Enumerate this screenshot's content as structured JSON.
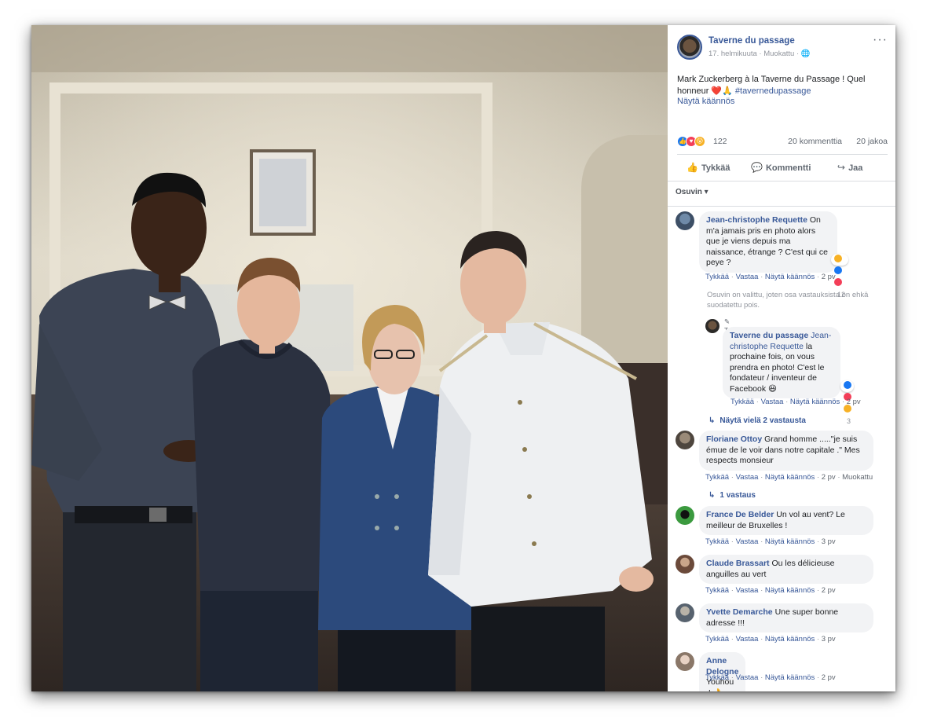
{
  "post": {
    "page_name": "Taverne du passage",
    "meta": "17. helmikuuta · Muokattu ·",
    "more_icon": "···",
    "text": "Mark Zuckerberg à la Taverne du Passage ! Quel honneur ❤️🙏",
    "hashtag": "#tavernedupassage",
    "see_translation": "Näytä käännös",
    "reaction_count": "122",
    "comments_count": "20 kommenttia",
    "shares_count": "20 jakoa",
    "actions": {
      "like": "Tykkää",
      "comment": "Kommentti",
      "share": "Jaa"
    },
    "sort_label": "Osuvin ▾"
  },
  "comments": [
    {
      "author": "Jean-christophe Requette",
      "text": "On m'a jamais pris en photo alors que je viens depuis ma naissance, étrange ? C'est qui ce peye ?",
      "reactions": "12",
      "links": {
        "like": "Tykkää",
        "reply": "Vastaa",
        "translate": "Näytä käännös",
        "time": "2 pv"
      }
    },
    {
      "note": "Osuvin on valittu, joten osa vastauksista on ehkä suodatettu pois."
    },
    {
      "badge": "✎ Tekijä",
      "author": "Taverne du passage",
      "mention": "Jean-christophe Requette",
      "text": "la prochaine fois, on vous prendra en photo! C'est le fondateur / inventeur de Facebook 😆",
      "reactions": "3",
      "links": {
        "like": "Tykkää",
        "reply": "Vastaa",
        "translate": "Näytä käännös",
        "time": "2 pv"
      }
    },
    {
      "more_replies": "Näytä vielä 2 vastausta"
    },
    {
      "author": "Floriane Ottoy",
      "text": "Grand homme .....\"je suis émue de le voir dans notre capitale .\" Mes respects monsieur",
      "links": {
        "like": "Tykkää",
        "reply": "Vastaa",
        "translate": "Näytä käännös",
        "time": "2 pv",
        "edited": "Muokattu"
      }
    },
    {
      "more_replies": "1 vastaus"
    },
    {
      "author": "France De Belder",
      "text": "Un vol au vent? Le meilleur de Bruxelles !",
      "links": {
        "like": "Tykkää",
        "reply": "Vastaa",
        "translate": "Näytä käännös",
        "time": "3 pv"
      }
    },
    {
      "author": "Claude Brassart",
      "text": "Ou les délicieuse anguilles au vert",
      "links": {
        "like": "Tykkää",
        "reply": "Vastaa",
        "translate": "Näytä käännös",
        "time": "2 pv"
      }
    },
    {
      "author": "Yvette Demarche",
      "text": "Une super bonne adresse !!!",
      "links": {
        "like": "Tykkää",
        "reply": "Vastaa",
        "translate": "Näytä käännös",
        "time": "3 pv"
      }
    },
    {
      "author": "Anne Delogne",
      "text": "Youhou ,! 👌",
      "links": {
        "like": "Tykkää",
        "reply": "Vastaa",
        "translate": "Näytä käännös",
        "time": "2 pv"
      }
    }
  ],
  "colors": {
    "link": "#385898",
    "like_blue": "#1877f2",
    "love_red": "#f33e58",
    "haha_yellow": "#f7b125",
    "bubble_bg": "#f2f3f5"
  }
}
